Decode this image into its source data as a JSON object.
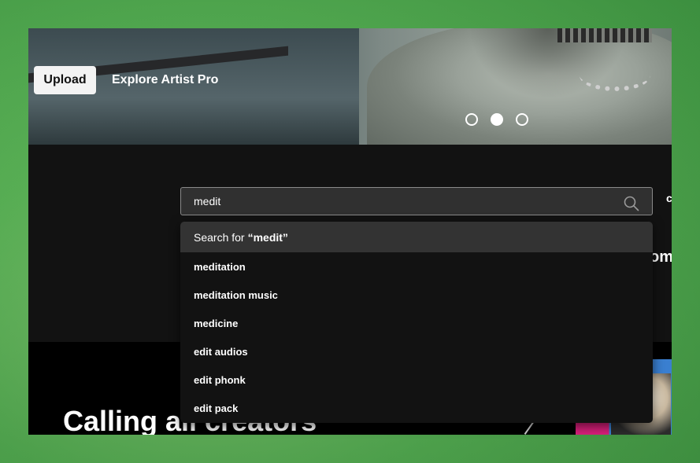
{
  "hero": {
    "upload_label": "Upload",
    "explore_label": "Explore Artist Pro",
    "carousel_dots": 3,
    "carousel_active_index": 1
  },
  "search": {
    "value": "medit",
    "suggestion_prefix": "Search for",
    "suggestion_query": "“medit”",
    "suggestions": [
      "meditation",
      "meditation music",
      "medicine",
      "edit audios",
      "edit phonk",
      "edit pack"
    ]
  },
  "clipped_right": {
    "text_a": "c",
    "text_b": "om"
  },
  "promo": {
    "title": "Calling all creators"
  },
  "colors": {
    "frame_green": "#5fb85a",
    "page_bg": "#121212",
    "dropdown_header_bg": "#333333",
    "input_bg": "#303030"
  },
  "icons": {
    "search": "search-icon"
  }
}
